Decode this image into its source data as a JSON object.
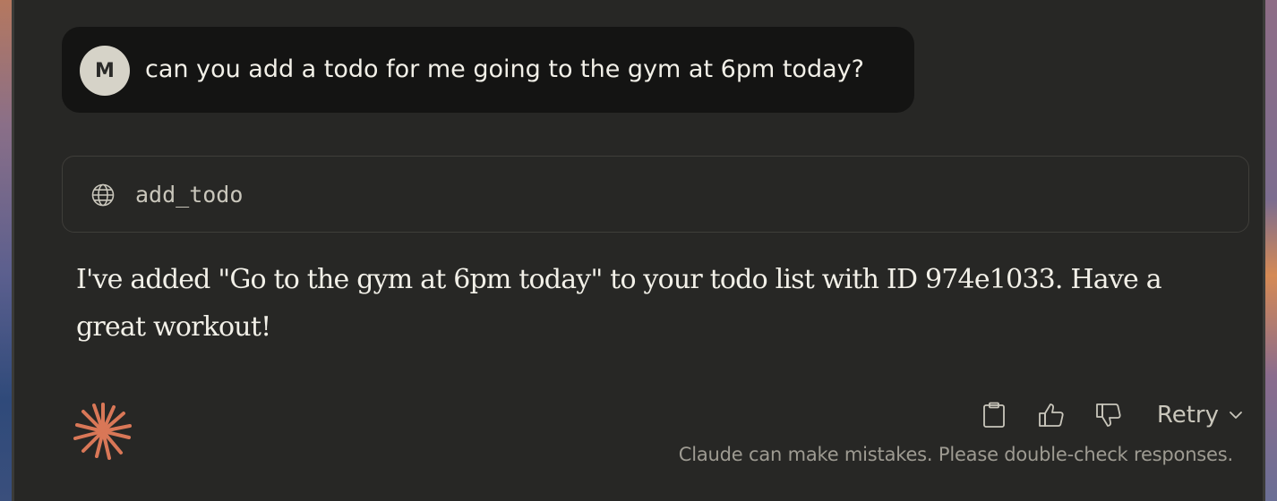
{
  "user_message": {
    "avatar_initial": "M",
    "text": "can you add a todo for me going to the gym at 6pm today?"
  },
  "tool_call": {
    "icon": "globe-icon",
    "name": "add_todo"
  },
  "assistant_message": {
    "text": "I've added \"Go to the gym at 6pm today\" to your todo list with ID 974e1033. Have a great workout!"
  },
  "actions": {
    "copy_icon": "clipboard-icon",
    "thumbs_up_icon": "thumbs-up-icon",
    "thumbs_down_icon": "thumbs-down-icon",
    "retry_label": "Retry",
    "retry_icon": "chevron-down-icon"
  },
  "disclaimer": "Claude can make mistakes. Please double-check responses.",
  "colors": {
    "background": "#272725",
    "user_bubble": "#141413",
    "avatar": "#d6d3c8",
    "accent": "#d97757",
    "text": "#f2f0e8",
    "muted_text": "#9e9b92"
  }
}
